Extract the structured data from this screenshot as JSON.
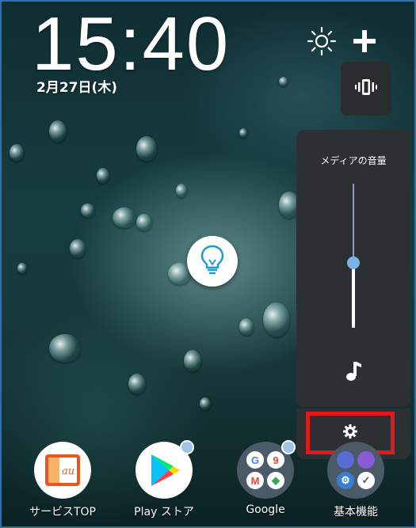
{
  "lockscreen": {
    "time": "15:40",
    "date": "2月27日(木)"
  },
  "top_icons": [
    {
      "name": "brightness-icon",
      "glyph": "☼"
    },
    {
      "name": "add-icon",
      "glyph": "+"
    }
  ],
  "volume_panel": {
    "label": "メディアの音量",
    "level": 0.45,
    "mode_icon": "vibrate-icon",
    "stream_icon": "music-note-icon",
    "settings_icon": "gear-icon"
  },
  "assistant_icon": "lightbulb-icon",
  "dock": {
    "apps": [
      {
        "label": "サービスTOP",
        "icon": "au-icon",
        "notification": false
      },
      {
        "label": "Play ストア",
        "icon": "play-store-icon",
        "notification": true
      },
      {
        "label": "Google",
        "icon": "google-folder-icon",
        "notification": true
      },
      {
        "label": "基本機能",
        "icon": "basic-functions-folder-icon",
        "notification": false
      }
    ]
  },
  "colors": {
    "highlight": "#e0191d",
    "panel": "#2d3032",
    "slider_thumb": "#7ab3e8",
    "frame": "#2a6fb8"
  }
}
